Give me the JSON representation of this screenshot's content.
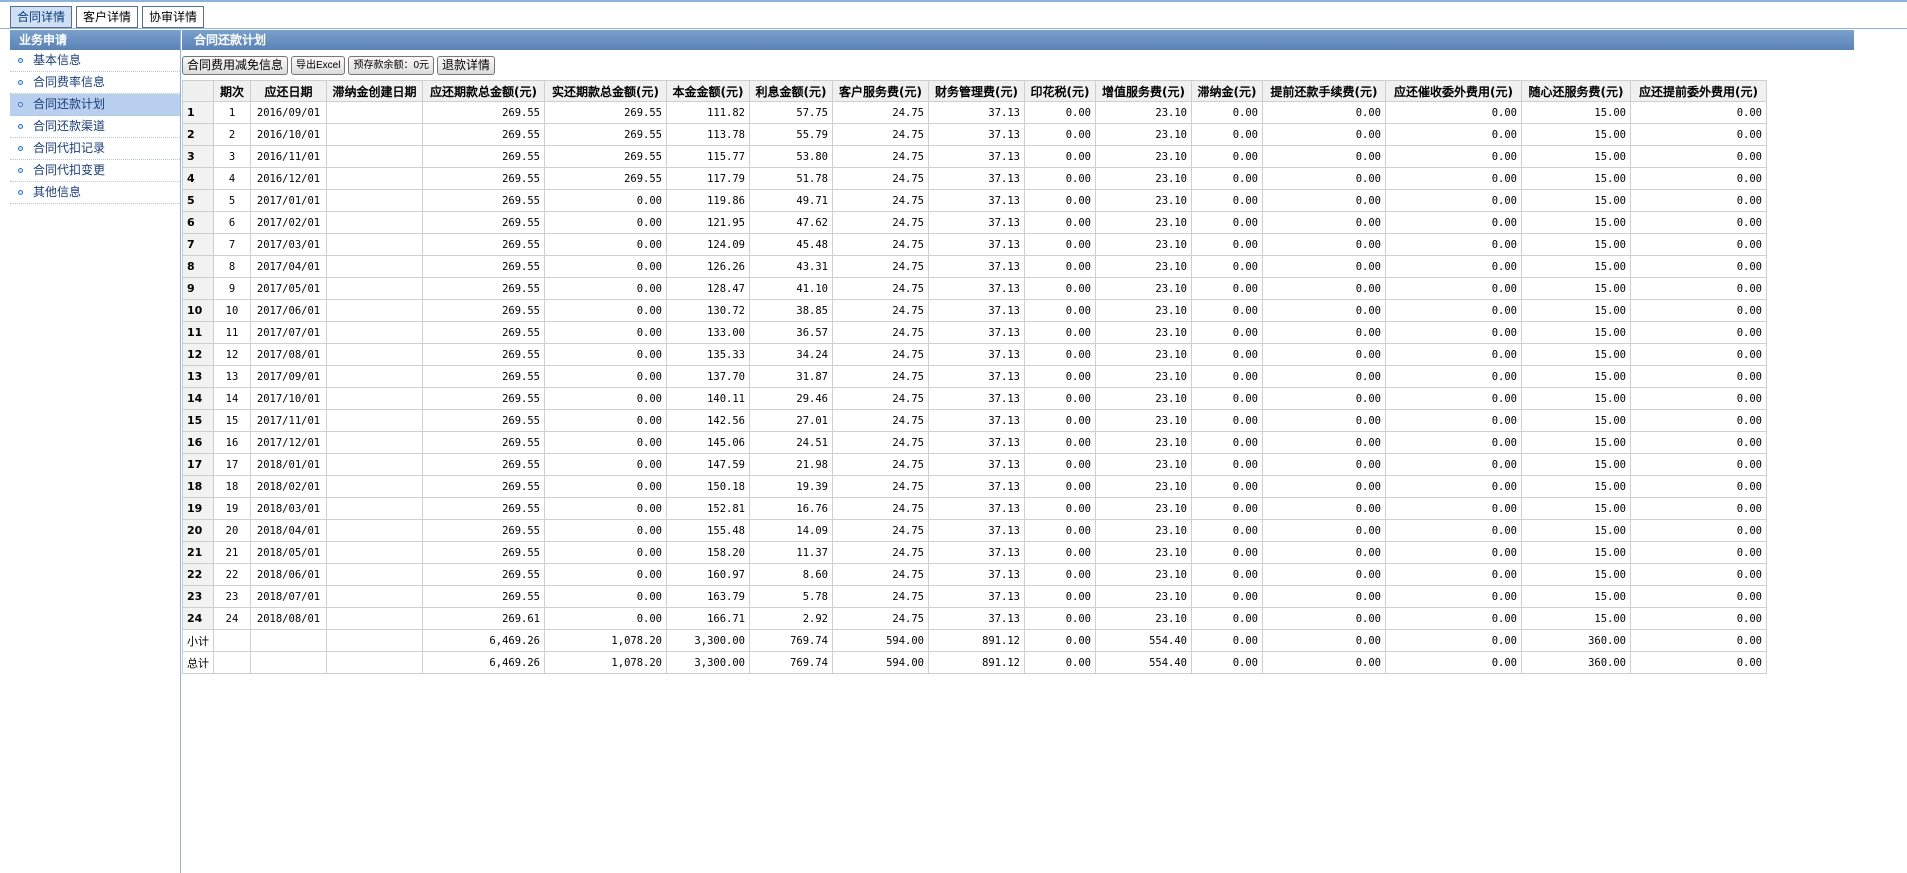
{
  "tabs": [
    "合同详情",
    "客户详情",
    "协审详情"
  ],
  "sidebar": {
    "title": "业务申请",
    "items": [
      "基本信息",
      "合同费率信息",
      "合同还款计划",
      "合同还款渠道",
      "合同代扣记录",
      "合同代扣变更",
      "其他信息"
    ],
    "selected_index": 2
  },
  "main": {
    "title": "合同还款计划",
    "buttons": [
      "合同费用减免信息",
      "导出Excel",
      "预存款余额：0元",
      "退款详情"
    ]
  },
  "table": {
    "headers": [
      "期次",
      "应还日期",
      "滞纳金创建日期",
      "应还期款总金额(元)",
      "实还期款总金额(元)",
      "本金金额(元)",
      "利息金额(元)",
      "客户服务费(元)",
      "财务管理费(元)",
      "印花税(元)",
      "增值服务费(元)",
      "滞纳金(元)",
      "提前还款手续费(元)",
      "应还催收委外费用(元)",
      "随心还服务费(元)",
      "应还提前委外费用(元)"
    ],
    "rows": [
      [
        "1",
        "1",
        "2016/09/01",
        "",
        "269.55",
        "269.55",
        "111.82",
        "57.75",
        "24.75",
        "37.13",
        "0.00",
        "23.10",
        "0.00",
        "0.00",
        "0.00",
        "15.00",
        "0.00"
      ],
      [
        "2",
        "2",
        "2016/10/01",
        "",
        "269.55",
        "269.55",
        "113.78",
        "55.79",
        "24.75",
        "37.13",
        "0.00",
        "23.10",
        "0.00",
        "0.00",
        "0.00",
        "15.00",
        "0.00"
      ],
      [
        "3",
        "3",
        "2016/11/01",
        "",
        "269.55",
        "269.55",
        "115.77",
        "53.80",
        "24.75",
        "37.13",
        "0.00",
        "23.10",
        "0.00",
        "0.00",
        "0.00",
        "15.00",
        "0.00"
      ],
      [
        "4",
        "4",
        "2016/12/01",
        "",
        "269.55",
        "269.55",
        "117.79",
        "51.78",
        "24.75",
        "37.13",
        "0.00",
        "23.10",
        "0.00",
        "0.00",
        "0.00",
        "15.00",
        "0.00"
      ],
      [
        "5",
        "5",
        "2017/01/01",
        "",
        "269.55",
        "0.00",
        "119.86",
        "49.71",
        "24.75",
        "37.13",
        "0.00",
        "23.10",
        "0.00",
        "0.00",
        "0.00",
        "15.00",
        "0.00"
      ],
      [
        "6",
        "6",
        "2017/02/01",
        "",
        "269.55",
        "0.00",
        "121.95",
        "47.62",
        "24.75",
        "37.13",
        "0.00",
        "23.10",
        "0.00",
        "0.00",
        "0.00",
        "15.00",
        "0.00"
      ],
      [
        "7",
        "7",
        "2017/03/01",
        "",
        "269.55",
        "0.00",
        "124.09",
        "45.48",
        "24.75",
        "37.13",
        "0.00",
        "23.10",
        "0.00",
        "0.00",
        "0.00",
        "15.00",
        "0.00"
      ],
      [
        "8",
        "8",
        "2017/04/01",
        "",
        "269.55",
        "0.00",
        "126.26",
        "43.31",
        "24.75",
        "37.13",
        "0.00",
        "23.10",
        "0.00",
        "0.00",
        "0.00",
        "15.00",
        "0.00"
      ],
      [
        "9",
        "9",
        "2017/05/01",
        "",
        "269.55",
        "0.00",
        "128.47",
        "41.10",
        "24.75",
        "37.13",
        "0.00",
        "23.10",
        "0.00",
        "0.00",
        "0.00",
        "15.00",
        "0.00"
      ],
      [
        "10",
        "10",
        "2017/06/01",
        "",
        "269.55",
        "0.00",
        "130.72",
        "38.85",
        "24.75",
        "37.13",
        "0.00",
        "23.10",
        "0.00",
        "0.00",
        "0.00",
        "15.00",
        "0.00"
      ],
      [
        "11",
        "11",
        "2017/07/01",
        "",
        "269.55",
        "0.00",
        "133.00",
        "36.57",
        "24.75",
        "37.13",
        "0.00",
        "23.10",
        "0.00",
        "0.00",
        "0.00",
        "15.00",
        "0.00"
      ],
      [
        "12",
        "12",
        "2017/08/01",
        "",
        "269.55",
        "0.00",
        "135.33",
        "34.24",
        "24.75",
        "37.13",
        "0.00",
        "23.10",
        "0.00",
        "0.00",
        "0.00",
        "15.00",
        "0.00"
      ],
      [
        "13",
        "13",
        "2017/09/01",
        "",
        "269.55",
        "0.00",
        "137.70",
        "31.87",
        "24.75",
        "37.13",
        "0.00",
        "23.10",
        "0.00",
        "0.00",
        "0.00",
        "15.00",
        "0.00"
      ],
      [
        "14",
        "14",
        "2017/10/01",
        "",
        "269.55",
        "0.00",
        "140.11",
        "29.46",
        "24.75",
        "37.13",
        "0.00",
        "23.10",
        "0.00",
        "0.00",
        "0.00",
        "15.00",
        "0.00"
      ],
      [
        "15",
        "15",
        "2017/11/01",
        "",
        "269.55",
        "0.00",
        "142.56",
        "27.01",
        "24.75",
        "37.13",
        "0.00",
        "23.10",
        "0.00",
        "0.00",
        "0.00",
        "15.00",
        "0.00"
      ],
      [
        "16",
        "16",
        "2017/12/01",
        "",
        "269.55",
        "0.00",
        "145.06",
        "24.51",
        "24.75",
        "37.13",
        "0.00",
        "23.10",
        "0.00",
        "0.00",
        "0.00",
        "15.00",
        "0.00"
      ],
      [
        "17",
        "17",
        "2018/01/01",
        "",
        "269.55",
        "0.00",
        "147.59",
        "21.98",
        "24.75",
        "37.13",
        "0.00",
        "23.10",
        "0.00",
        "0.00",
        "0.00",
        "15.00",
        "0.00"
      ],
      [
        "18",
        "18",
        "2018/02/01",
        "",
        "269.55",
        "0.00",
        "150.18",
        "19.39",
        "24.75",
        "37.13",
        "0.00",
        "23.10",
        "0.00",
        "0.00",
        "0.00",
        "15.00",
        "0.00"
      ],
      [
        "19",
        "19",
        "2018/03/01",
        "",
        "269.55",
        "0.00",
        "152.81",
        "16.76",
        "24.75",
        "37.13",
        "0.00",
        "23.10",
        "0.00",
        "0.00",
        "0.00",
        "15.00",
        "0.00"
      ],
      [
        "20",
        "20",
        "2018/04/01",
        "",
        "269.55",
        "0.00",
        "155.48",
        "14.09",
        "24.75",
        "37.13",
        "0.00",
        "23.10",
        "0.00",
        "0.00",
        "0.00",
        "15.00",
        "0.00"
      ],
      [
        "21",
        "21",
        "2018/05/01",
        "",
        "269.55",
        "0.00",
        "158.20",
        "11.37",
        "24.75",
        "37.13",
        "0.00",
        "23.10",
        "0.00",
        "0.00",
        "0.00",
        "15.00",
        "0.00"
      ],
      [
        "22",
        "22",
        "2018/06/01",
        "",
        "269.55",
        "0.00",
        "160.97",
        "8.60",
        "24.75",
        "37.13",
        "0.00",
        "23.10",
        "0.00",
        "0.00",
        "0.00",
        "15.00",
        "0.00"
      ],
      [
        "23",
        "23",
        "2018/07/01",
        "",
        "269.55",
        "0.00",
        "163.79",
        "5.78",
        "24.75",
        "37.13",
        "0.00",
        "23.10",
        "0.00",
        "0.00",
        "0.00",
        "15.00",
        "0.00"
      ],
      [
        "24",
        "24",
        "2018/08/01",
        "",
        "269.61",
        "0.00",
        "166.71",
        "2.92",
        "24.75",
        "37.13",
        "0.00",
        "23.10",
        "0.00",
        "0.00",
        "0.00",
        "15.00",
        "0.00"
      ]
    ],
    "summary": [
      [
        "小计",
        "",
        "",
        "",
        "6,469.26",
        "1,078.20",
        "3,300.00",
        "769.74",
        "594.00",
        "891.12",
        "0.00",
        "554.40",
        "0.00",
        "0.00",
        "0.00",
        "360.00",
        "0.00"
      ],
      [
        "总计",
        "",
        "",
        "",
        "6,469.26",
        "1,078.20",
        "3,300.00",
        "769.74",
        "594.00",
        "891.12",
        "0.00",
        "554.40",
        "0.00",
        "0.00",
        "0.00",
        "360.00",
        "0.00"
      ]
    ]
  }
}
